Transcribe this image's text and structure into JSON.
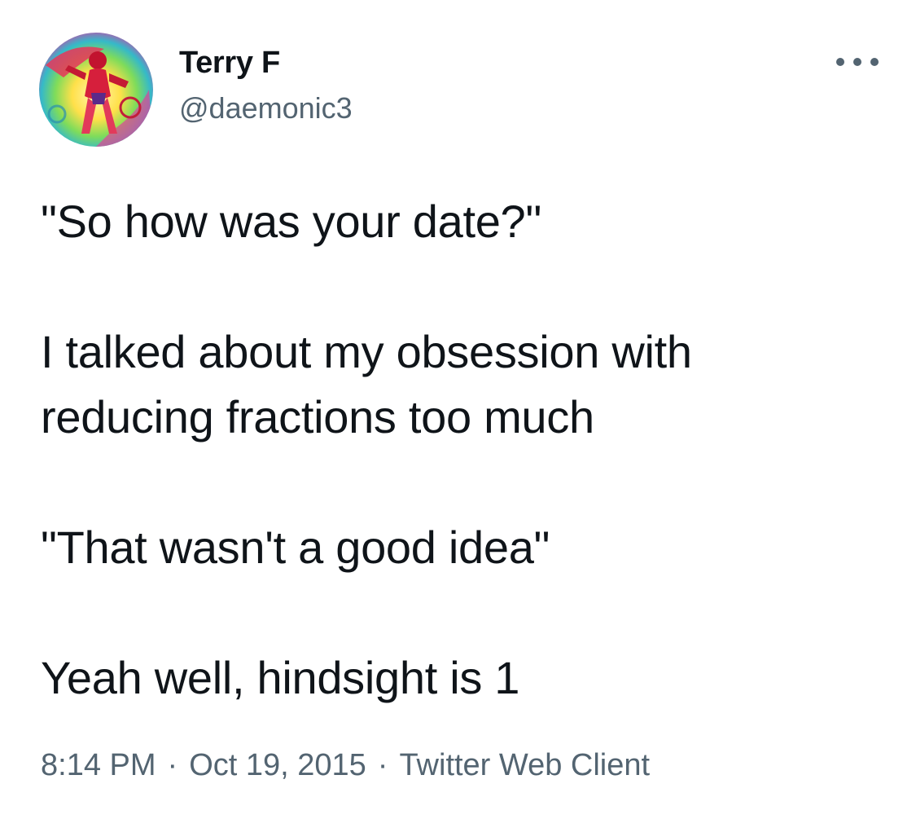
{
  "author": {
    "display_name": "Terry F",
    "handle": "@daemonic3"
  },
  "tweet": {
    "lines": [
      "\"So how was your date?\"",
      "I talked about my obsession with",
      "reducing fractions too much",
      "\"That wasn't a good idea\"",
      "Yeah well, hindsight is 1"
    ]
  },
  "meta": {
    "time": "8:14 PM",
    "separator": "·",
    "date": "Oct 19, 2015",
    "source": "Twitter Web Client"
  },
  "icons": {
    "more": "more-horizontal-icon"
  },
  "colors": {
    "text_primary": "#0f1419",
    "text_secondary": "#536471",
    "background": "#ffffff"
  }
}
